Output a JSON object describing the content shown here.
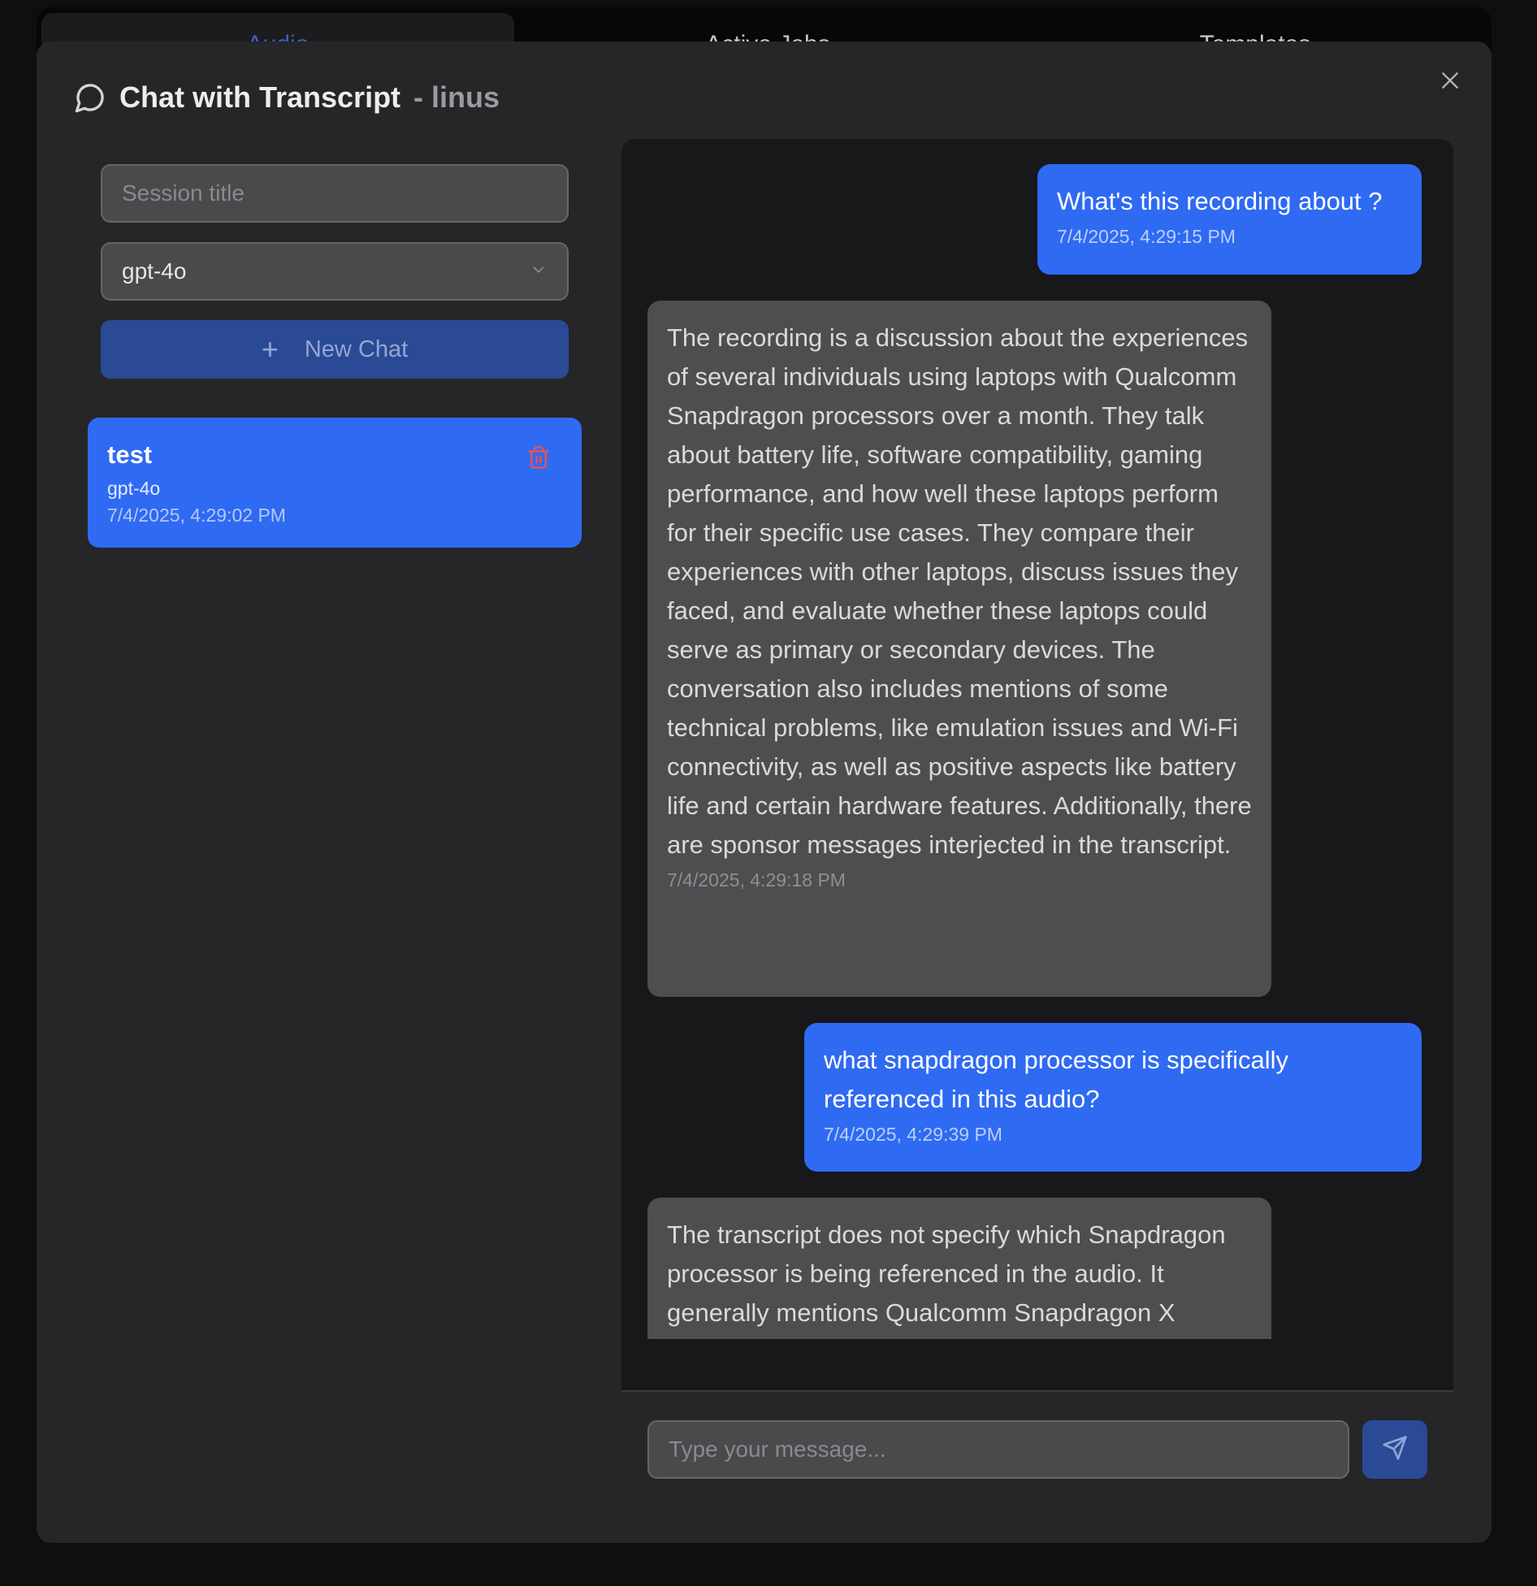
{
  "tabs": [
    {
      "label": "Audio"
    },
    {
      "label": "Active Jobs"
    },
    {
      "label": "Templates"
    }
  ],
  "modal": {
    "title": "Chat with Transcript",
    "subtitle": "- linus",
    "icon": "chat-bubble-icon",
    "close_icon": "close-icon"
  },
  "sidebar": {
    "session_title_placeholder": "Session title",
    "session_title_value": "",
    "model_select": {
      "value": "gpt-4o",
      "icon": "chevron-down-icon"
    },
    "new_chat_label": "New Chat",
    "sessions": [
      {
        "title": "test",
        "model": "gpt-4o",
        "time": "7/4/2025, 4:29:02 PM",
        "active": true,
        "delete_icon": "trash-icon"
      }
    ]
  },
  "chat": {
    "messages": [
      {
        "role": "user",
        "text": "What's this recording about ?",
        "time": "7/4/2025, 4:29:15 PM"
      },
      {
        "role": "assistant",
        "text": "The recording is a discussion about the experiences of several individuals using laptops with Qualcomm Snapdragon processors over a month. They talk about battery life, software compatibility, gaming performance, and how well these laptops perform for their specific use cases. They compare their experiences with other laptops, discuss issues they faced, and evaluate whether these laptops could serve as primary or secondary devices. The conversation also includes mentions of some technical problems, like emulation issues and Wi-Fi connectivity, as well as positive aspects like battery life and certain hardware features. Additionally, there are sponsor messages interjected in the transcript.",
        "time": "7/4/2025, 4:29:18 PM"
      },
      {
        "role": "user",
        "text": "what snapdragon processor is specifically referenced in this audio?",
        "time": "7/4/2025, 4:29:39 PM"
      },
      {
        "role": "assistant",
        "text": "The transcript does not specify which Snapdragon processor is being referenced in the audio. It generally mentions Qualcomm Snapdragon X laptops, but no specific model or",
        "time": ""
      }
    ],
    "input_placeholder": "Type your message...",
    "input_value": "",
    "send_icon": "send-icon"
  },
  "colors": {
    "accent": "#2f6af3",
    "button_muted": "#2a4a96",
    "modal_bg": "#262628",
    "chat_bg": "#18181a",
    "assistant_bubble": "#4e4e51",
    "delete_icon": "#e25555"
  }
}
